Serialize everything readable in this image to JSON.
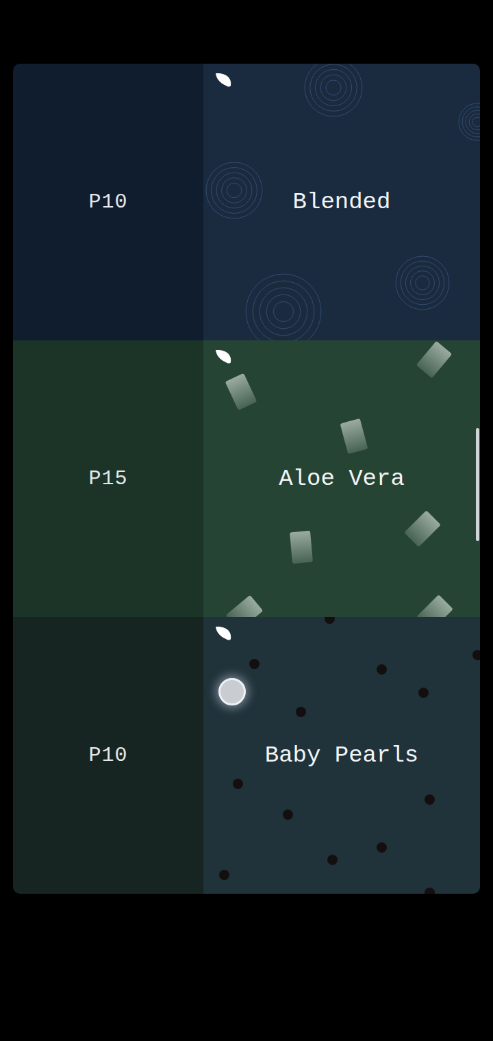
{
  "items": [
    {
      "price": "P10",
      "name": "Blended",
      "kind": "ripples",
      "color": "#1b2b3f",
      "side_color": "#0f1d2f"
    },
    {
      "price": "P15",
      "name": "Aloe Vera",
      "kind": "aloe",
      "color": "#264433",
      "side_color": "#1b3427"
    },
    {
      "price": "P10",
      "name": "Baby Pearls",
      "kind": "pearls",
      "color": "#20323a",
      "side_color": "#162522"
    }
  ]
}
